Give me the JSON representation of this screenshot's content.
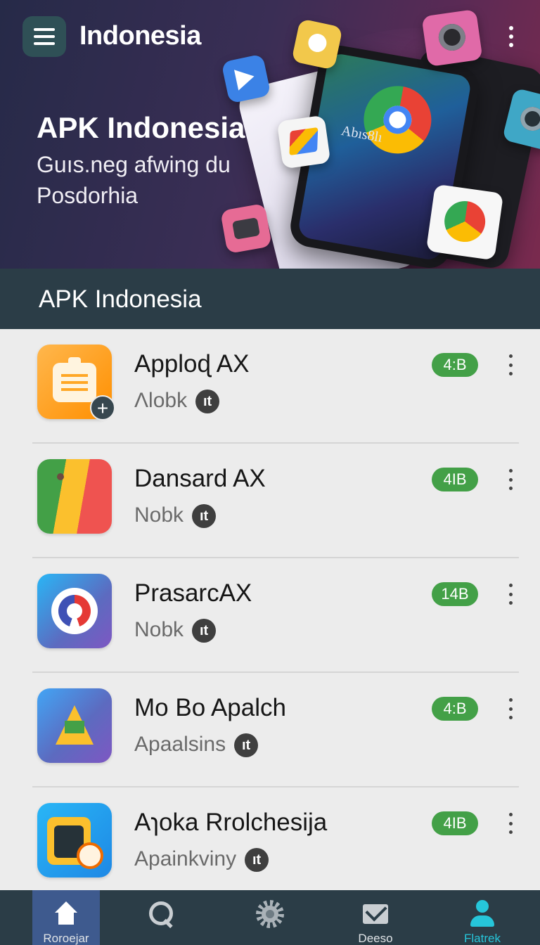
{
  "header": {
    "title": "Indonesia",
    "hero_title": "APK Indonesia",
    "hero_subtitle": "Guıs.neg afwing du Posdorhia",
    "phone_text": "Abıs8lı"
  },
  "section": {
    "title": "APK Indonesia"
  },
  "apps": [
    {
      "name": "Apploɖ AX",
      "sub": "Λlobk",
      "size": "4:B",
      "badge": "ıt"
    },
    {
      "name": "Dansard AX",
      "sub": "Nobk",
      "size": "4IB",
      "badge": "ıt"
    },
    {
      "name": "PrasarcAX",
      "sub": "Nobk",
      "size": "14B",
      "badge": "ıt"
    },
    {
      "name": "Mo Bo Apalch",
      "sub": "Apaalsins",
      "size": "4:B",
      "badge": "ıt"
    },
    {
      "name": "Aɿoka Rrolchesija",
      "sub": "Apainkviny",
      "size": "4IB",
      "badge": "ıt"
    }
  ],
  "bottom_nav": [
    {
      "label": "Roroejar",
      "icon": "home-icon"
    },
    {
      "label": "",
      "icon": "search-icon"
    },
    {
      "label": "",
      "icon": "gear-icon"
    },
    {
      "label": "Deeso",
      "icon": "mail-icon"
    },
    {
      "label": "Flatrek",
      "icon": "user-icon"
    }
  ],
  "colors": {
    "accent_green": "#43a047",
    "header_dark": "#2b3d47",
    "nav_active": "#3e5a8e",
    "teal": "#26c6da"
  }
}
